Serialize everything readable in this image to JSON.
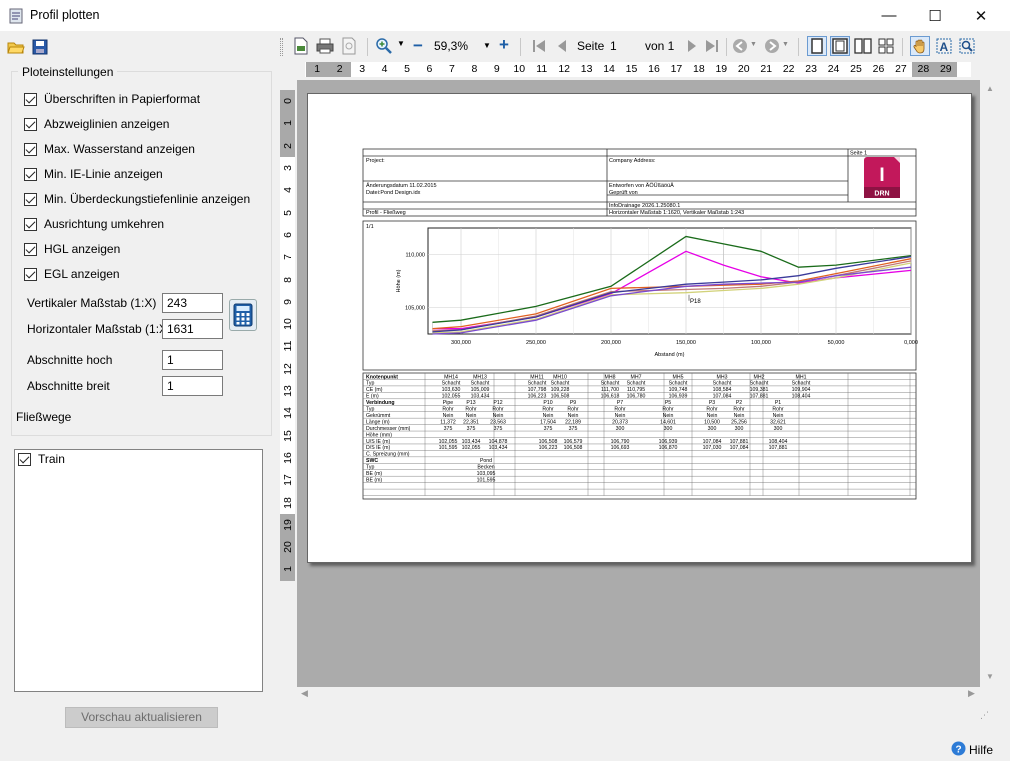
{
  "window": {
    "title": "Profil plotten",
    "minimize": "—",
    "maximize": "☐",
    "close": "✕"
  },
  "left_toolbar": {
    "icons": [
      "folder-open-icon",
      "save-icon"
    ]
  },
  "settings": {
    "title": "Ploteinstellungen",
    "options": [
      {
        "label": "Überschriften in Papierformat",
        "checked": true
      },
      {
        "label": "Abzweiglinien anzeigen",
        "checked": true
      },
      {
        "label": "Max. Wasserstand anzeigen",
        "checked": true
      },
      {
        "label": "Min. IE-Linie anzeigen",
        "checked": true
      },
      {
        "label": "Min. Überdeckungstiefenlinie anzeigen",
        "checked": true
      },
      {
        "label": "Ausrichtung umkehren",
        "checked": true
      },
      {
        "label": "HGL anzeigen",
        "checked": true
      },
      {
        "label": "EGL anzeigen",
        "checked": true
      }
    ],
    "fields": [
      {
        "label": "Vertikaler Maßstab (1:X)",
        "value": "243"
      },
      {
        "label": "Horizontaler Maßstab (1:X)",
        "value": "1631"
      },
      {
        "label": "Abschnitte hoch",
        "value": "1"
      },
      {
        "label": "Abschnitte breit",
        "value": "1"
      }
    ]
  },
  "flow_paths": {
    "title": "Fließwege",
    "items": [
      {
        "label": "Train",
        "checked": true
      }
    ]
  },
  "update_button": "Vorschau aktualisieren",
  "toolbar": {
    "zoom": "59,3%",
    "zoom_minus": "−",
    "zoom_plus": "+",
    "page_label": "Seite",
    "page_value": "1",
    "page_of": "von 1"
  },
  "ruler_top": {
    "numbers": [
      "1",
      "2",
      "3",
      "4",
      "5",
      "6",
      "7",
      "8",
      "9",
      "10",
      "11",
      "12",
      "13",
      "14",
      "15",
      "16",
      "17",
      "18",
      "19",
      "20",
      "21",
      "22",
      "23",
      "24",
      "25",
      "26",
      "27",
      "28",
      "29"
    ],
    "shaded": [
      "1",
      "2",
      "28",
      "29"
    ]
  },
  "ruler_left": {
    "numbers": [
      "0",
      "1",
      "2",
      "3",
      "4",
      "5",
      "6",
      "7",
      "8",
      "9",
      "10",
      "11",
      "12",
      "13",
      "14",
      "15",
      "16",
      "17",
      "18",
      "19",
      "20",
      "1"
    ],
    "shaded": [
      "0",
      "1",
      "2",
      "19",
      "20",
      "1"
    ]
  },
  "sheet": {
    "page_label": "Seite 1",
    "project": "Project:",
    "company": "Company Address:",
    "change_date": "Änderungsdatum 11.02.2015",
    "data_file": "Datei:Pond Design.idx",
    "drawn_by": "Entworfen von ÄÖÜßäöüÄ",
    "checked_by": "Geprüft von",
    "version": "InfoDrainage 2026.1.25080.1",
    "profile": "Profil - Fließweg",
    "scale": "Horizontaler Maßstab 1:1620, Vertikaler Maßstab 1:243",
    "logo_letter": "I",
    "logo_text": "DRN",
    "section": "1/1"
  },
  "chart_data": {
    "type": "line",
    "xlabel": "Abstand (m)",
    "ylabel": "Höhe (m)",
    "x_reversed": true,
    "xticks": [
      300,
      250,
      200,
      150,
      100,
      50,
      0
    ],
    "xtick_labels": [
      "300,000",
      "250,000",
      "200,000",
      "150,000",
      "100,000",
      "50,000",
      "0,000"
    ],
    "yticks": [
      105,
      110
    ],
    "ytick_labels": [
      "105,000",
      "110,000"
    ],
    "xlim": [
      0,
      322
    ],
    "ylim": [
      102.5,
      112.5
    ],
    "annotations": [
      {
        "text": "P18",
        "x": 148,
        "y": 106.2
      }
    ],
    "series": [
      {
        "color": "#1a6b1a",
        "x": [
          319,
          300,
          250,
          200,
          150,
          125,
          100,
          75,
          50,
          0
        ],
        "y": [
          103.6,
          103.8,
          105.1,
          107.0,
          111.7,
          111.0,
          110.3,
          108.8,
          109.0,
          109.9
        ]
      },
      {
        "color": "#e600e6",
        "x": [
          319,
          300,
          250,
          200,
          150,
          125,
          100,
          75,
          50,
          0
        ],
        "y": [
          103.0,
          103.0,
          104.1,
          106.3,
          110.3,
          109.0,
          107.9,
          107.3,
          107.8,
          108.5
        ]
      },
      {
        "color": "#e06020",
        "x": [
          319,
          300,
          250,
          200,
          150,
          125,
          100,
          75,
          50,
          0
        ],
        "y": [
          103.0,
          103.2,
          104.4,
          106.8,
          107.0,
          107.1,
          107.2,
          107.5,
          108.2,
          109.6
        ]
      },
      {
        "color": "#c07878",
        "x": [
          319,
          300,
          250,
          200,
          150,
          125,
          100,
          75,
          50,
          0
        ],
        "y": [
          102.8,
          102.9,
          104.2,
          106.5,
          106.7,
          106.8,
          107.0,
          107.4,
          108.0,
          109.4
        ]
      },
      {
        "color": "#d2d27a",
        "x": [
          319,
          300,
          250,
          200,
          150,
          125,
          100,
          75,
          50,
          0
        ],
        "y": [
          102.6,
          102.7,
          103.9,
          106.2,
          106.4,
          106.6,
          106.8,
          107.2,
          107.8,
          109.2
        ]
      },
      {
        "color": "#7a4ad0",
        "x": [
          319,
          300,
          250,
          200,
          150,
          125,
          100,
          75,
          50,
          0
        ],
        "y": [
          102.5,
          102.6,
          103.8,
          106.1,
          107.0,
          107.2,
          107.3,
          107.4,
          108.0,
          108.8
        ]
      },
      {
        "color": "#3a3a9a",
        "x": [
          319,
          300,
          250,
          200,
          150,
          125,
          100,
          75,
          50,
          0
        ],
        "y": [
          102.7,
          102.9,
          104.1,
          106.4,
          107.2,
          107.4,
          107.6,
          108.0,
          108.7,
          109.8
        ]
      }
    ]
  },
  "table": {
    "nodes_heading": "Knotenpunkt",
    "node_names": [
      "MH14",
      "MH13",
      "MH11",
      "MH10",
      "MH8",
      "MH7",
      "MH5",
      "MH3",
      "MH2",
      "MH1"
    ],
    "node_rows": [
      {
        "label": "Typ",
        "values": [
          "Schacht",
          "Schacht",
          "Schacht",
          "Schacht",
          "Schacht",
          "Schacht",
          "Schacht",
          "Schacht",
          "Schacht",
          "Schacht"
        ]
      },
      {
        "label": "CE (m)",
        "values": [
          "103,630",
          "105,009",
          "107,798",
          "109,228",
          "111,700",
          "110,795",
          "109,748",
          "108,584",
          "109,381",
          "109,904"
        ]
      },
      {
        "label": "E (m)",
        "values": [
          "102,055",
          "103,434",
          "106,223",
          "106,508",
          "106,618",
          "106,780",
          "106,939",
          "107,084",
          "107,881",
          "108,404"
        ]
      }
    ],
    "links_heading": "Verbindung",
    "link_names": [
      "Pipe",
      "P13",
      "P12",
      "P10",
      "P9",
      "P7",
      "P5",
      "P3",
      "P2",
      "P1"
    ],
    "link_rows": [
      {
        "label": "Typ",
        "values": [
          "Rohr",
          "Rohr",
          "Rohr",
          "Rohr",
          "Rohr",
          "Rohr",
          "Rohr",
          "Rohr",
          "Rohr",
          "Rohr"
        ]
      },
      {
        "label": "Gekrümmt",
        "values": [
          "Nein",
          "Nein",
          "Nein",
          "Nein",
          "Nein",
          "Nein",
          "Nein",
          "Nein",
          "Nein",
          "Nein"
        ]
      },
      {
        "label": "Länge (m)",
        "values": [
          "11,372",
          "22,351",
          "23,563",
          "17,504",
          "22,189",
          "20,373",
          "14,601",
          "10,500",
          "25,256",
          "32,621"
        ]
      },
      {
        "label": "Durchmesser (mm)",
        "values": [
          "375",
          "375",
          "375",
          "375",
          "375",
          "300",
          "300",
          "300",
          "300",
          "300"
        ]
      },
      {
        "label": "Höhe (mm)",
        "values": [
          "",
          "",
          "",
          "",
          "",
          "",
          "",
          "",
          "",
          ""
        ]
      },
      {
        "label": "U/S IE (m)",
        "values": [
          "102,055",
          "103,434",
          "104,878",
          "106,508",
          "106,579",
          "106,790",
          "106,939",
          "107,084",
          "107,881",
          "108,404"
        ]
      },
      {
        "label": "D/S IE (m)",
        "values": [
          "101,595",
          "102,055",
          "103,434",
          "106,223",
          "106,508",
          "106,693",
          "106,870",
          "107,030",
          "107,084",
          "107,881"
        ]
      },
      {
        "label": "C. Spreizung (mm)",
        "values": [
          "",
          "",
          "",
          "",
          "",
          "",
          "",
          "",
          "",
          ""
        ]
      }
    ],
    "swc_heading": "SWC",
    "swc_name": "Pond",
    "swc_rows": [
      {
        "label": "Typ",
        "value": "Becken"
      },
      {
        "label": "BE (m)",
        "value": "103,095"
      },
      {
        "label": "BE (m)",
        "value": "101,595"
      }
    ]
  },
  "help": {
    "label": "Hilfe"
  }
}
